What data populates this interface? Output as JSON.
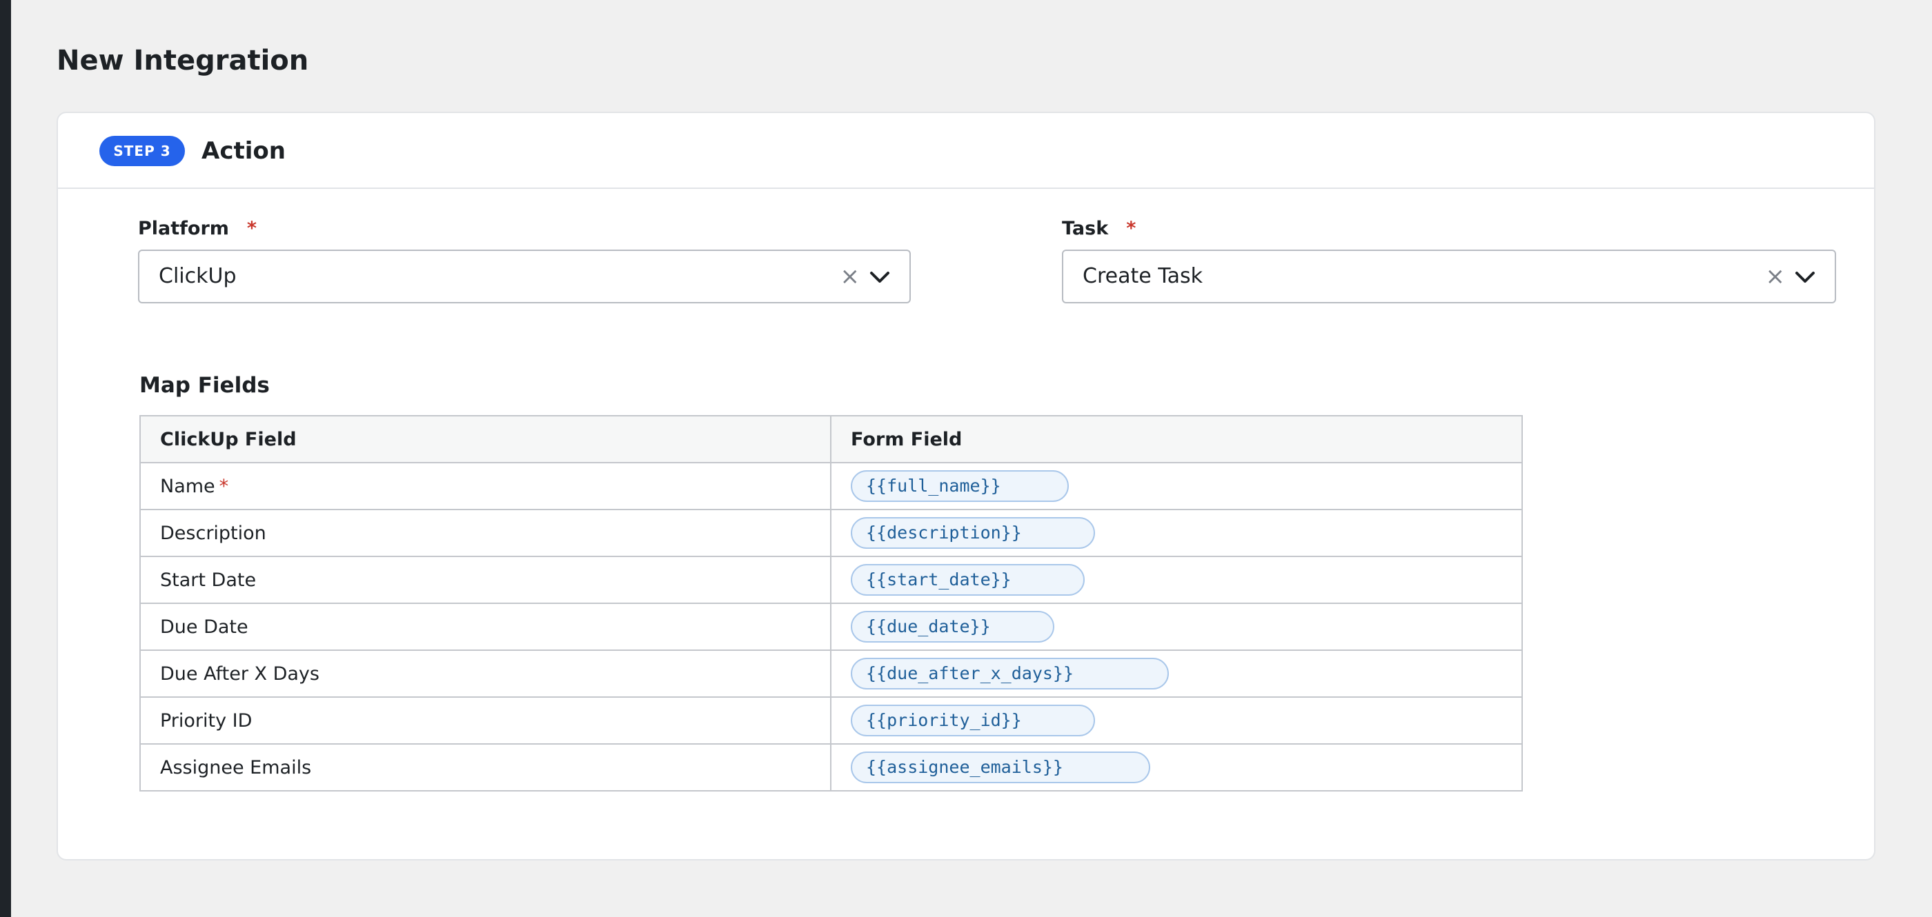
{
  "page": {
    "title": "New Integration"
  },
  "step": {
    "badge": "STEP 3",
    "title": "Action"
  },
  "platform": {
    "label": "Platform",
    "required_mark": "*",
    "value": "ClickUp",
    "clear_glyph": "×"
  },
  "task": {
    "label": "Task",
    "required_mark": "*",
    "value": "Create Task",
    "clear_glyph": "×"
  },
  "map_fields": {
    "title": "Map Fields",
    "columns": [
      "ClickUp Field",
      "Form Field"
    ],
    "rows": [
      {
        "field": "Name",
        "required_mark": "*",
        "token": "{{full_name}}"
      },
      {
        "field": "Description",
        "token": "{{description}}"
      },
      {
        "field": "Start Date",
        "token": "{{start_date}}"
      },
      {
        "field": "Due Date",
        "token": "{{due_date}}"
      },
      {
        "field": "Due After X Days",
        "token": "{{due_after_x_days}}"
      },
      {
        "field": "Priority ID",
        "token": "{{priority_id}}"
      },
      {
        "field": "Assignee Emails",
        "token": "{{assignee_emails}}"
      }
    ]
  },
  "colors": {
    "accent": "#2563eb",
    "required": "#c9372c",
    "token_text": "#1f5f99",
    "token_background": "#eef5fc"
  },
  "icons": {
    "clear": "close-icon",
    "dropdown": "chevron-down-icon"
  }
}
